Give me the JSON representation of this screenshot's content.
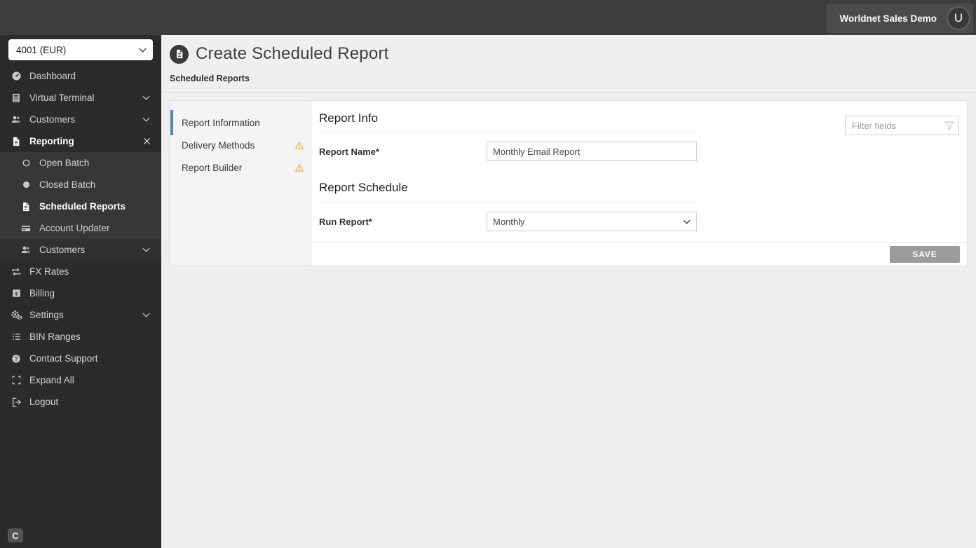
{
  "colors": {
    "topbar_bg": "#3d3d3d",
    "sidebar_bg": "#2b2b2b",
    "submenu_bg": "#373737",
    "accent_tab": "#5b84ab",
    "warning": "#efa32b",
    "save_button": "#9b9b9b"
  },
  "topbar": {
    "account_label": "Worldnet Sales Demo",
    "avatar_initial": "U"
  },
  "sidebar": {
    "merchant_select_value": "4001 (EUR)",
    "items": [
      {
        "label": "Dashboard",
        "icon": "dashboard-icon"
      },
      {
        "label": "Virtual Terminal",
        "icon": "terminal-icon",
        "trailing": "chevron"
      },
      {
        "label": "Customers",
        "icon": "users-icon",
        "trailing": "chevron"
      },
      {
        "label": "Reporting",
        "icon": "document-icon",
        "trailing": "close",
        "bold": true
      },
      {
        "label": "Open Batch",
        "icon": "circle-outline-icon",
        "submenu": true
      },
      {
        "label": "Closed Batch",
        "icon": "circle-filled-icon",
        "submenu": true
      },
      {
        "label": "Scheduled Reports",
        "icon": "document-icon",
        "submenu": true,
        "bold": true
      },
      {
        "label": "Account Updater",
        "icon": "card-icon",
        "submenu": true
      },
      {
        "label": "Customers",
        "icon": "users-icon",
        "submenu": true,
        "trailing": "chevron",
        "shade": true
      },
      {
        "label": "FX Rates",
        "icon": "fx-icon"
      },
      {
        "label": "Billing",
        "icon": "billing-icon"
      },
      {
        "label": "Settings",
        "icon": "settings-icon",
        "trailing": "chevron"
      },
      {
        "label": "BIN Ranges",
        "icon": "list-icon"
      },
      {
        "label": "Contact Support",
        "icon": "help-icon"
      },
      {
        "label": "Expand All",
        "icon": "expand-icon"
      },
      {
        "label": "Logout",
        "icon": "logout-icon"
      }
    ],
    "footer_badge": "C"
  },
  "header": {
    "title": "Create Scheduled Report",
    "title_icon": "document-icon",
    "breadcrumb": "Scheduled Reports"
  },
  "panel": {
    "tabs": [
      {
        "label": "Report Information",
        "active": true
      },
      {
        "label": "Delivery Methods",
        "warning": true
      },
      {
        "label": "Report Builder",
        "warning": true
      }
    ],
    "filter": {
      "placeholder": "Filter fields"
    },
    "sections": [
      {
        "title": "Report Info",
        "fields": [
          {
            "label": "Report Name*",
            "type": "text",
            "value": "Monthly Email Report"
          }
        ]
      },
      {
        "title": "Report Schedule",
        "fields": [
          {
            "label": "Run Report*",
            "type": "select",
            "value": "Monthly"
          }
        ]
      }
    ],
    "save_label": "SAVE"
  }
}
